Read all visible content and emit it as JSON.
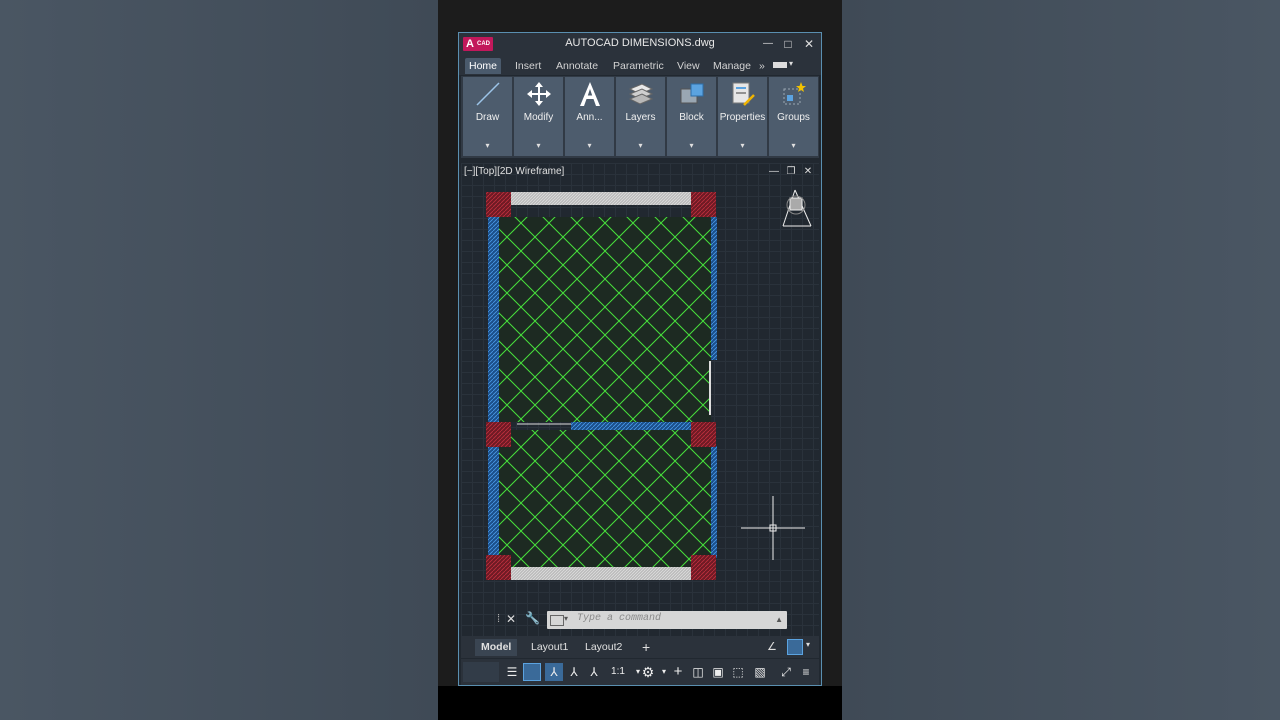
{
  "window": {
    "title": "AUTOCAD DIMENSIONS.dwg",
    "logo_letter": "A",
    "logo_sub": "CAD"
  },
  "window_controls": {
    "minimize": "—",
    "maximize": "□",
    "close": "✕"
  },
  "ribbon_tabs": [
    {
      "label": "Home",
      "active": true
    },
    {
      "label": "Insert"
    },
    {
      "label": "Annotate"
    },
    {
      "label": "Parametric"
    },
    {
      "label": "View"
    },
    {
      "label": "Manage"
    }
  ],
  "ribbon_overflow": "»",
  "ribbon_panels": [
    {
      "label": "Draw",
      "icon": "line-icon"
    },
    {
      "label": "Modify",
      "icon": "move-icon"
    },
    {
      "label": "Ann...",
      "icon": "text-icon"
    },
    {
      "label": "Layers",
      "icon": "layers-icon"
    },
    {
      "label": "Block",
      "icon": "block-icon"
    },
    {
      "label": "Properties",
      "icon": "properties-icon"
    },
    {
      "label": "Groups",
      "icon": "groups-icon"
    }
  ],
  "dropdown_glyph": "▾",
  "viewport": {
    "label": "[−][Top][2D Wireframe]",
    "controls": [
      "—",
      "❐",
      "✕"
    ]
  },
  "command": {
    "placeholder": "Type a command"
  },
  "layouts": [
    {
      "label": "Model",
      "active": true
    },
    {
      "label": "Layout1"
    },
    {
      "label": "Layout2"
    },
    {
      "label": "+"
    }
  ],
  "status": {
    "scale": "1:1"
  },
  "colors": {
    "hatch_green": "#46e03c",
    "wall_blue": "#2f7fd6",
    "column_red": "#8a1e2a",
    "window_gray": "#cfcfcf",
    "logo_accent": "#c2185b"
  }
}
